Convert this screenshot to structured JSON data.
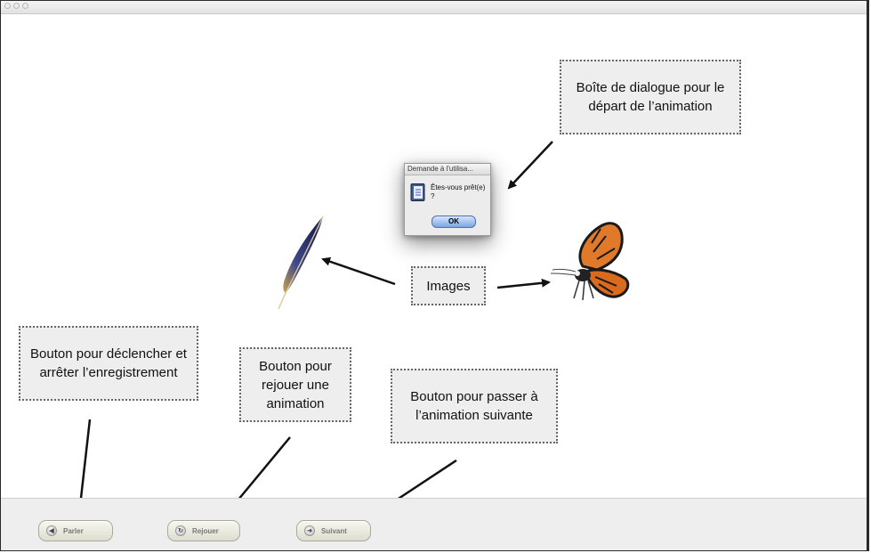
{
  "callouts": {
    "dialog_note": "Boîte de dialogue pour le départ de l’animation",
    "images_note": "Images",
    "speak_note": "Bouton pour déclencher et arrêter l’enregistrement",
    "replay_note": "Bouton pour rejouer une animation",
    "next_note": "Bouton pour passer à l’animation suivante"
  },
  "dialog": {
    "title": "Demande à l'utilisa...",
    "message": "Êtes-vous prêt(e) ?",
    "ok_label": "OK"
  },
  "toolbar": {
    "speak_label": "Parler",
    "replay_label": "Rejouer",
    "next_label": "Suivant"
  },
  "colors": {
    "callout_fill": "#eeeeee",
    "ok_button": "#7aa5e3",
    "butterfly_wing": "#e07a2a"
  }
}
